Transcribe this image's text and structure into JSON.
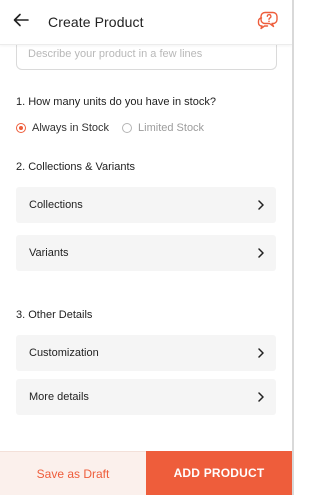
{
  "header": {
    "title": "Create Product",
    "back_icon": "arrow-left-icon",
    "help_icon": "help-chat-icon"
  },
  "description": {
    "placeholder": "Describe your product in a few lines"
  },
  "stock": {
    "title": "1. How many units do you have in stock?",
    "options": [
      {
        "label": "Always in Stock",
        "selected": true
      },
      {
        "label": "Limited Stock",
        "selected": false
      }
    ]
  },
  "collections_variants": {
    "title": "2. Collections & Variants",
    "items": [
      {
        "label": "Collections"
      },
      {
        "label": "Variants"
      }
    ]
  },
  "other_details": {
    "title": "3. Other Details",
    "items": [
      {
        "label": "Customization"
      },
      {
        "label": "More details"
      }
    ]
  },
  "footer": {
    "draft_label": "Save as Draft",
    "add_label": "ADD PRODUCT"
  },
  "colors": {
    "accent": "#ee5d3b",
    "draft_bg": "#fbf0ec",
    "row_bg": "#f5f5f5"
  }
}
